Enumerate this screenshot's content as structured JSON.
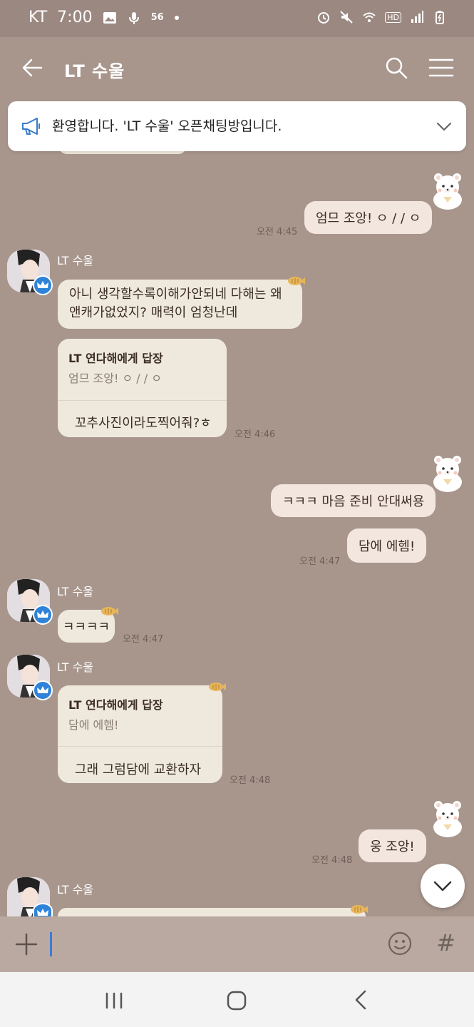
{
  "status_bar": {
    "carrier": "KT",
    "time": "7:00",
    "network_badge": "56",
    "hd_badge": "HD"
  },
  "header": {
    "title": "LT 수울"
  },
  "notice": {
    "text": "환영합니다. 'LT 수울' 오픈채팅방입니다."
  },
  "messages": [
    {
      "side": "me",
      "text": "엄므 조앙! ㅇ / / ㅇ",
      "time": "오전 4:45"
    },
    {
      "side": "other",
      "sender": "LT 수울",
      "line1": "아니 생각할수록이해가안되네 다해는 왜",
      "line2": "앤캐가없었지? 매력이 엄청난데"
    },
    {
      "side": "other",
      "reply_head": "LT 연다해에게 답장",
      "reply_quote": "엄므 조앙! ㅇ / / ㅇ",
      "text": "꼬추사진이라도찍어줘?ㅎ",
      "time": "오전 4:46"
    },
    {
      "side": "me",
      "text": "ㅋㅋㅋ 마음 준비 안대써용"
    },
    {
      "side": "me",
      "text": "담에 에헴!",
      "time": "오전 4:47"
    },
    {
      "side": "other",
      "sender": "LT 수울",
      "text": "ㅋㅋㅋㅋ",
      "time": "오전 4:47"
    },
    {
      "side": "other",
      "sender": "LT 수울",
      "reply_head": "LT 연다해에게 답장",
      "reply_quote": "담에 에헴!",
      "text": "그래 그럼담에 교환하자",
      "time": "오전 4:48"
    },
    {
      "side": "me",
      "text": "웅 조앙!",
      "time": "오전 4:48"
    },
    {
      "side": "other",
      "sender": "LT 수울"
    }
  ],
  "input_bar": {
    "hash_label": "#"
  },
  "colors": {
    "background": "#a8968d",
    "my_bubble": "#f3e6df",
    "other_bubble": "#efe9dd",
    "crown_badge": "#2e83d9"
  }
}
